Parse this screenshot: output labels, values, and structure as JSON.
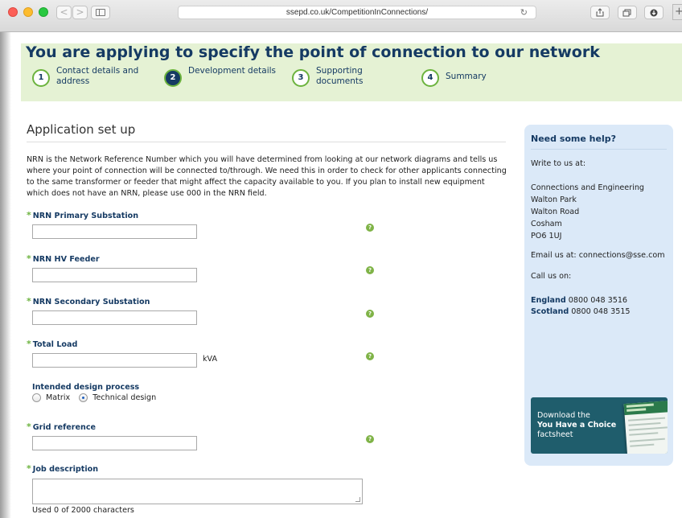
{
  "browser": {
    "url": "ssepd.co.uk/CompetitionInConnections/",
    "back_glyph": "<",
    "forward_glyph": ">",
    "reload_glyph": "↻",
    "new_tab_glyph": "+"
  },
  "header": {
    "title": "You are applying to specify the point of connection to our network",
    "steps": [
      {
        "number": "1",
        "label": "Contact details and address",
        "state": "done"
      },
      {
        "number": "2",
        "label": "Development details",
        "state": "current"
      },
      {
        "number": "3",
        "label": "Supporting documents",
        "state": "upcoming"
      },
      {
        "number": "4",
        "label": "Summary",
        "state": "upcoming"
      }
    ]
  },
  "main": {
    "section_title": "Application set up",
    "intro": "NRN is the Network Reference Number which you will have determined from looking at our network diagrams and tells us where your point of connection will be connected to/through. We need this in order to check for other applicants connecting to the same transformer or feeder that might affect the capacity available to you. If you plan to install new equipment which does not have an NRN, please use 000 in the NRN field.",
    "required_marker": "*",
    "help_glyph": "?",
    "fields": {
      "primary_substation": {
        "label": "NRN Primary Substation",
        "value": ""
      },
      "hv_feeder": {
        "label": "NRN HV Feeder",
        "value": ""
      },
      "secondary_substation": {
        "label": "NRN Secondary Substation",
        "value": ""
      },
      "total_load": {
        "label": "Total Load",
        "value": "",
        "unit": "kVA"
      },
      "grid_reference": {
        "label": "Grid reference",
        "value": ""
      },
      "job_description": {
        "label": "Job description",
        "value": ""
      }
    },
    "design_process": {
      "label": "Intended design process",
      "options": [
        "Matrix",
        "Technical design"
      ],
      "selected": "Technical design"
    },
    "char_counter": "Used 0 of 2000 characters"
  },
  "help_panel": {
    "title": "Need some help?",
    "write_to": "Write to us at:",
    "address": [
      "Connections and Engineering",
      "Walton Park",
      "Walton Road",
      "Cosham",
      "PO6 1UJ"
    ],
    "email": "Email us at: connections@sse.com",
    "call": "Call us on:",
    "phones": [
      {
        "region": "England",
        "number": "0800 048 3516"
      },
      {
        "region": "Scotland",
        "number": "0800 048 3515"
      }
    ],
    "factsheet": {
      "line1": "Download the",
      "line2": "You Have a Choice",
      "line3": "factsheet"
    }
  },
  "colors": {
    "brand_navy": "#153a63",
    "brand_green": "#6cb33e",
    "header_band": "#e5f2d4",
    "help_panel": "#dbe9f8",
    "factsheet_bg": "#1f5d6c"
  },
  "icons": [
    "back-icon",
    "forward-icon",
    "sidebar-icon",
    "reload-icon",
    "share-icon",
    "tabs-icon",
    "download-icon",
    "help-icon",
    "resize-handle-icon"
  ]
}
